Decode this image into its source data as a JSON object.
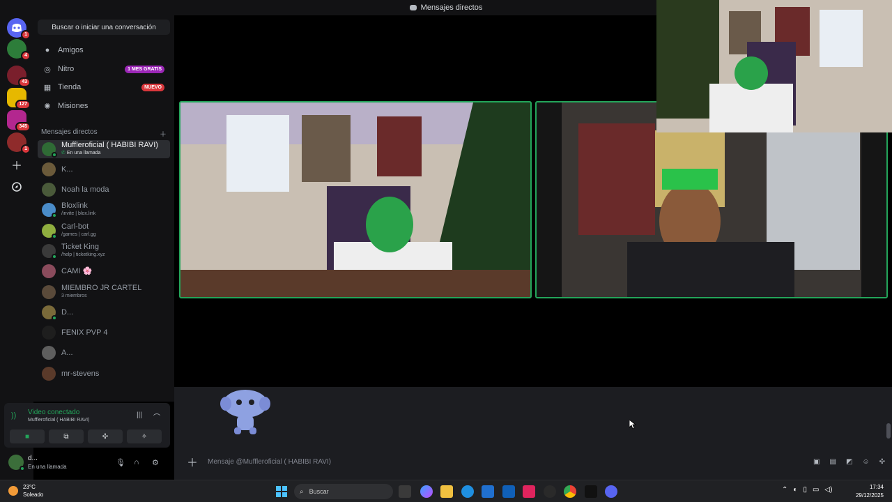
{
  "window": {
    "title": "Mensajes directos"
  },
  "sidebar": {
    "search_label": "Buscar o iniciar una conversación",
    "nav": [
      {
        "label": "Amigos",
        "icon": "friends-icon",
        "badge": ""
      },
      {
        "label": "Nitro",
        "icon": "nitro-icon",
        "badge": "1 MES GRATIS",
        "badge_color": "#9b26b6"
      },
      {
        "label": "Tienda",
        "icon": "shop-icon",
        "badge": "NUEVO",
        "badge_color": "#da373c"
      },
      {
        "label": "Misiones",
        "icon": "quests-icon",
        "badge": ""
      }
    ],
    "dm_header": "Mensajes directos",
    "dms": [
      {
        "name": "Muffleroficial ( HABIBI RAVI)",
        "sub": "En una llamada",
        "active": true
      },
      {
        "name": "K...",
        "sub": ""
      },
      {
        "name": "Noah la moda",
        "sub": ""
      },
      {
        "name": "Bloxlink",
        "sub": "/invite | blox.link"
      },
      {
        "name": "Carl-bot",
        "sub": "/games | carl.gg"
      },
      {
        "name": "Ticket King",
        "sub": "/help | ticketking.xyz"
      },
      {
        "name": "CAMI 🌸",
        "sub": ""
      },
      {
        "name": "MIEMBRO JR CARTEL",
        "sub": "3 miembros"
      },
      {
        "name": "D...",
        "sub": ""
      },
      {
        "name": "FENIX PVP 4",
        "sub": ""
      },
      {
        "name": "A...",
        "sub": ""
      },
      {
        "name": "mr-stevens",
        "sub": ""
      }
    ]
  },
  "servers": {
    "badges": [
      "1",
      "4",
      "43",
      "127",
      "345",
      "1"
    ]
  },
  "voice": {
    "title": "Video conectado",
    "channel": "Muffleroficial ( HABIBI RAVI)"
  },
  "user": {
    "name": "d...",
    "status": "En una llamada"
  },
  "composer": {
    "placeholder": "Mensaje @Muffleroficial ( HABIBI RAVI)"
  },
  "taskbar": {
    "weather_temp": "23°C",
    "weather_desc": "Soleado",
    "search_label": "Buscar",
    "time": "17:34",
    "date": "29/12/2025"
  },
  "colors": {
    "accent_green": "#23a55a",
    "background": "#121214",
    "blurple": "#5865f2"
  }
}
